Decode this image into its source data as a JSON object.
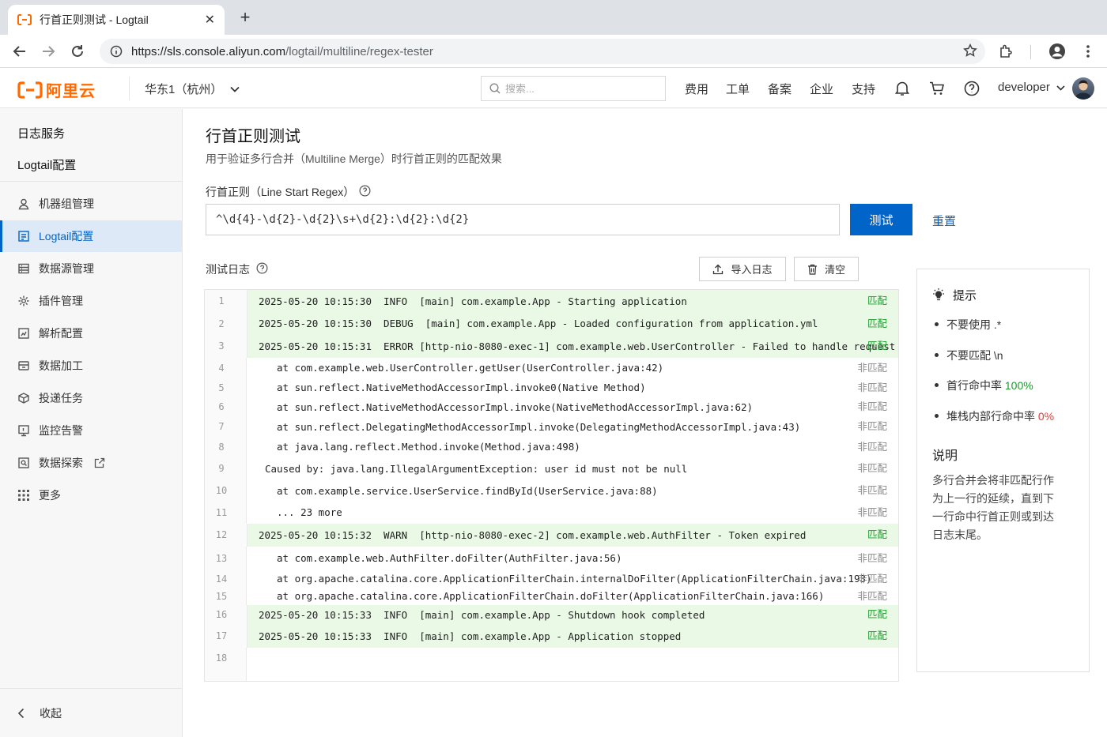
{
  "browser": {
    "tab_title": "行首正则测试 - Logtail",
    "url_host": "https://sls.console.aliyun.com",
    "url_path": "/logtail/multiline/regex-tester"
  },
  "header": {
    "logo_text": "阿里云",
    "region": "华东1（杭州）",
    "search_placeholder": "搜索...",
    "nav": [
      "费用",
      "工单",
      "备案",
      "企业",
      "支持"
    ],
    "user": "developer"
  },
  "sidebar": {
    "service_title": "日志服务",
    "section_title": "Logtail配置",
    "items": [
      {
        "label": "机器组管理",
        "icon": "user-icon"
      },
      {
        "label": "Logtail配置",
        "icon": "config-icon"
      },
      {
        "label": "数据源管理",
        "icon": "database-icon"
      },
      {
        "label": "插件管理",
        "icon": "plugin-icon"
      },
      {
        "label": "解析配置",
        "icon": "parse-icon"
      },
      {
        "label": "数据加工",
        "icon": "process-icon"
      },
      {
        "label": "投递任务",
        "icon": "deliver-icon"
      },
      {
        "label": "监控告警",
        "icon": "monitor-icon"
      },
      {
        "label": "数据探索",
        "icon": "explore-icon"
      },
      {
        "label": "更多",
        "icon": "grid-icon"
      }
    ],
    "collapse_label": "收起"
  },
  "main": {
    "title": "行首正则测试",
    "description": "用于验证多行合并（Multiline Merge）时行首正则的匹配效果",
    "regex_label": "行首正则（Line Start Regex）",
    "regex_value": "^\\d{4}-\\d{2}-\\d{2}\\s+\\d{2}:\\d{2}:\\d{2}",
    "test_button": "测试",
    "reset_link": "重置",
    "log_label": "测试日志",
    "import_button": "导入日志",
    "clear_button": "清空",
    "status_match": "匹配",
    "status_nomatch": "非匹配",
    "lines": [
      {
        "n": "1",
        "text": "2025-05-20 10:15:30  INFO  [main] com.example.App - Starting application",
        "status": "匹配"
      },
      {
        "n": "2",
        "text": "2025-05-20 10:15:30  DEBUG  [main] com.example.App - Loaded configuration from application.yml",
        "status": "匹配"
      },
      {
        "n": "3",
        "text": "2025-05-20 10:15:31  ERROR [http-nio-8080-exec-1] com.example.web.UserController - Failed to handle request",
        "status": "匹配"
      },
      {
        "n": "4",
        "text": "at com.example.web.UserController.getUser(UserController.java:42)",
        "status": "非匹配"
      },
      {
        "n": "5",
        "text": "at sun.reflect.NativeMethodAccessorImpl.invoke0(Native Method)",
        "status": "非匹配"
      },
      {
        "n": "6",
        "text": "at sun.reflect.NativeMethodAccessorImpl.invoke(NativeMethodAccessorImpl.java:62)",
        "status": "非匹配"
      },
      {
        "n": "7",
        "text": "at sun.reflect.DelegatingMethodAccessorImpl.invoke(DelegatingMethodAccessorImpl.java:43)",
        "status": "非匹配"
      },
      {
        "n": "8",
        "text": "at java.lang.reflect.Method.invoke(Method.java:498)",
        "status": "非匹配"
      },
      {
        "n": "9",
        "text": "Caused by: java.lang.IllegalArgumentException: user id must not be null",
        "status": "非匹配"
      },
      {
        "n": "10",
        "text": "at com.example.service.UserService.findById(UserService.java:88)",
        "status": "非匹配"
      },
      {
        "n": "11",
        "text": "... 23 more",
        "status": "非匹配"
      },
      {
        "n": "12",
        "text": "2025-05-20 10:15:32  WARN  [http-nio-8080-exec-2] com.example.web.AuthFilter - Token expired",
        "status": "匹配"
      },
      {
        "n": "13",
        "text": "at com.example.web.AuthFilter.doFilter(AuthFilter.java:56)",
        "status": "非匹配"
      },
      {
        "n": "14",
        "text": "at org.apache.catalina.core.ApplicationFilterChain.internalDoFilter(ApplicationFilterChain.java:193)",
        "status": "非匹配"
      },
      {
        "n": "15",
        "text": "at org.apache.catalina.core.ApplicationFilterChain.doFilter(ApplicationFilterChain.java:166)",
        "status": "非匹配"
      },
      {
        "n": "16",
        "text": "2025-05-20 10:15:33  INFO  [main] com.example.App - Shutdown hook completed",
        "status": "匹配"
      },
      {
        "n": "17",
        "text": "2025-05-20 10:15:33  INFO  [main] com.example.App - Application stopped",
        "status": "匹配"
      },
      {
        "n": "18",
        "text": "",
        "status": ""
      }
    ]
  },
  "tips": {
    "title": "提示",
    "items": [
      {
        "text": "不要使用 .*",
        "value": "",
        "tone": ""
      },
      {
        "text": "不要匹配 \\n",
        "value": "",
        "tone": ""
      },
      {
        "text": "首行命中率 ",
        "value": "100%",
        "tone": "green"
      },
      {
        "text": "堆栈内部行命中率 ",
        "value": "0%",
        "tone": "red"
      }
    ],
    "section_title": "说明",
    "paragraph": "多行合并会将非匹配行作为上一行的延续，直到下一行命中行首正则或到达日志末尾。"
  },
  "colors": {
    "primary": "#0064c8",
    "brand": "#ff6a00",
    "match": "#1a9d2c",
    "match_bg": "#eaf8e6",
    "danger": "#e23b3b"
  }
}
